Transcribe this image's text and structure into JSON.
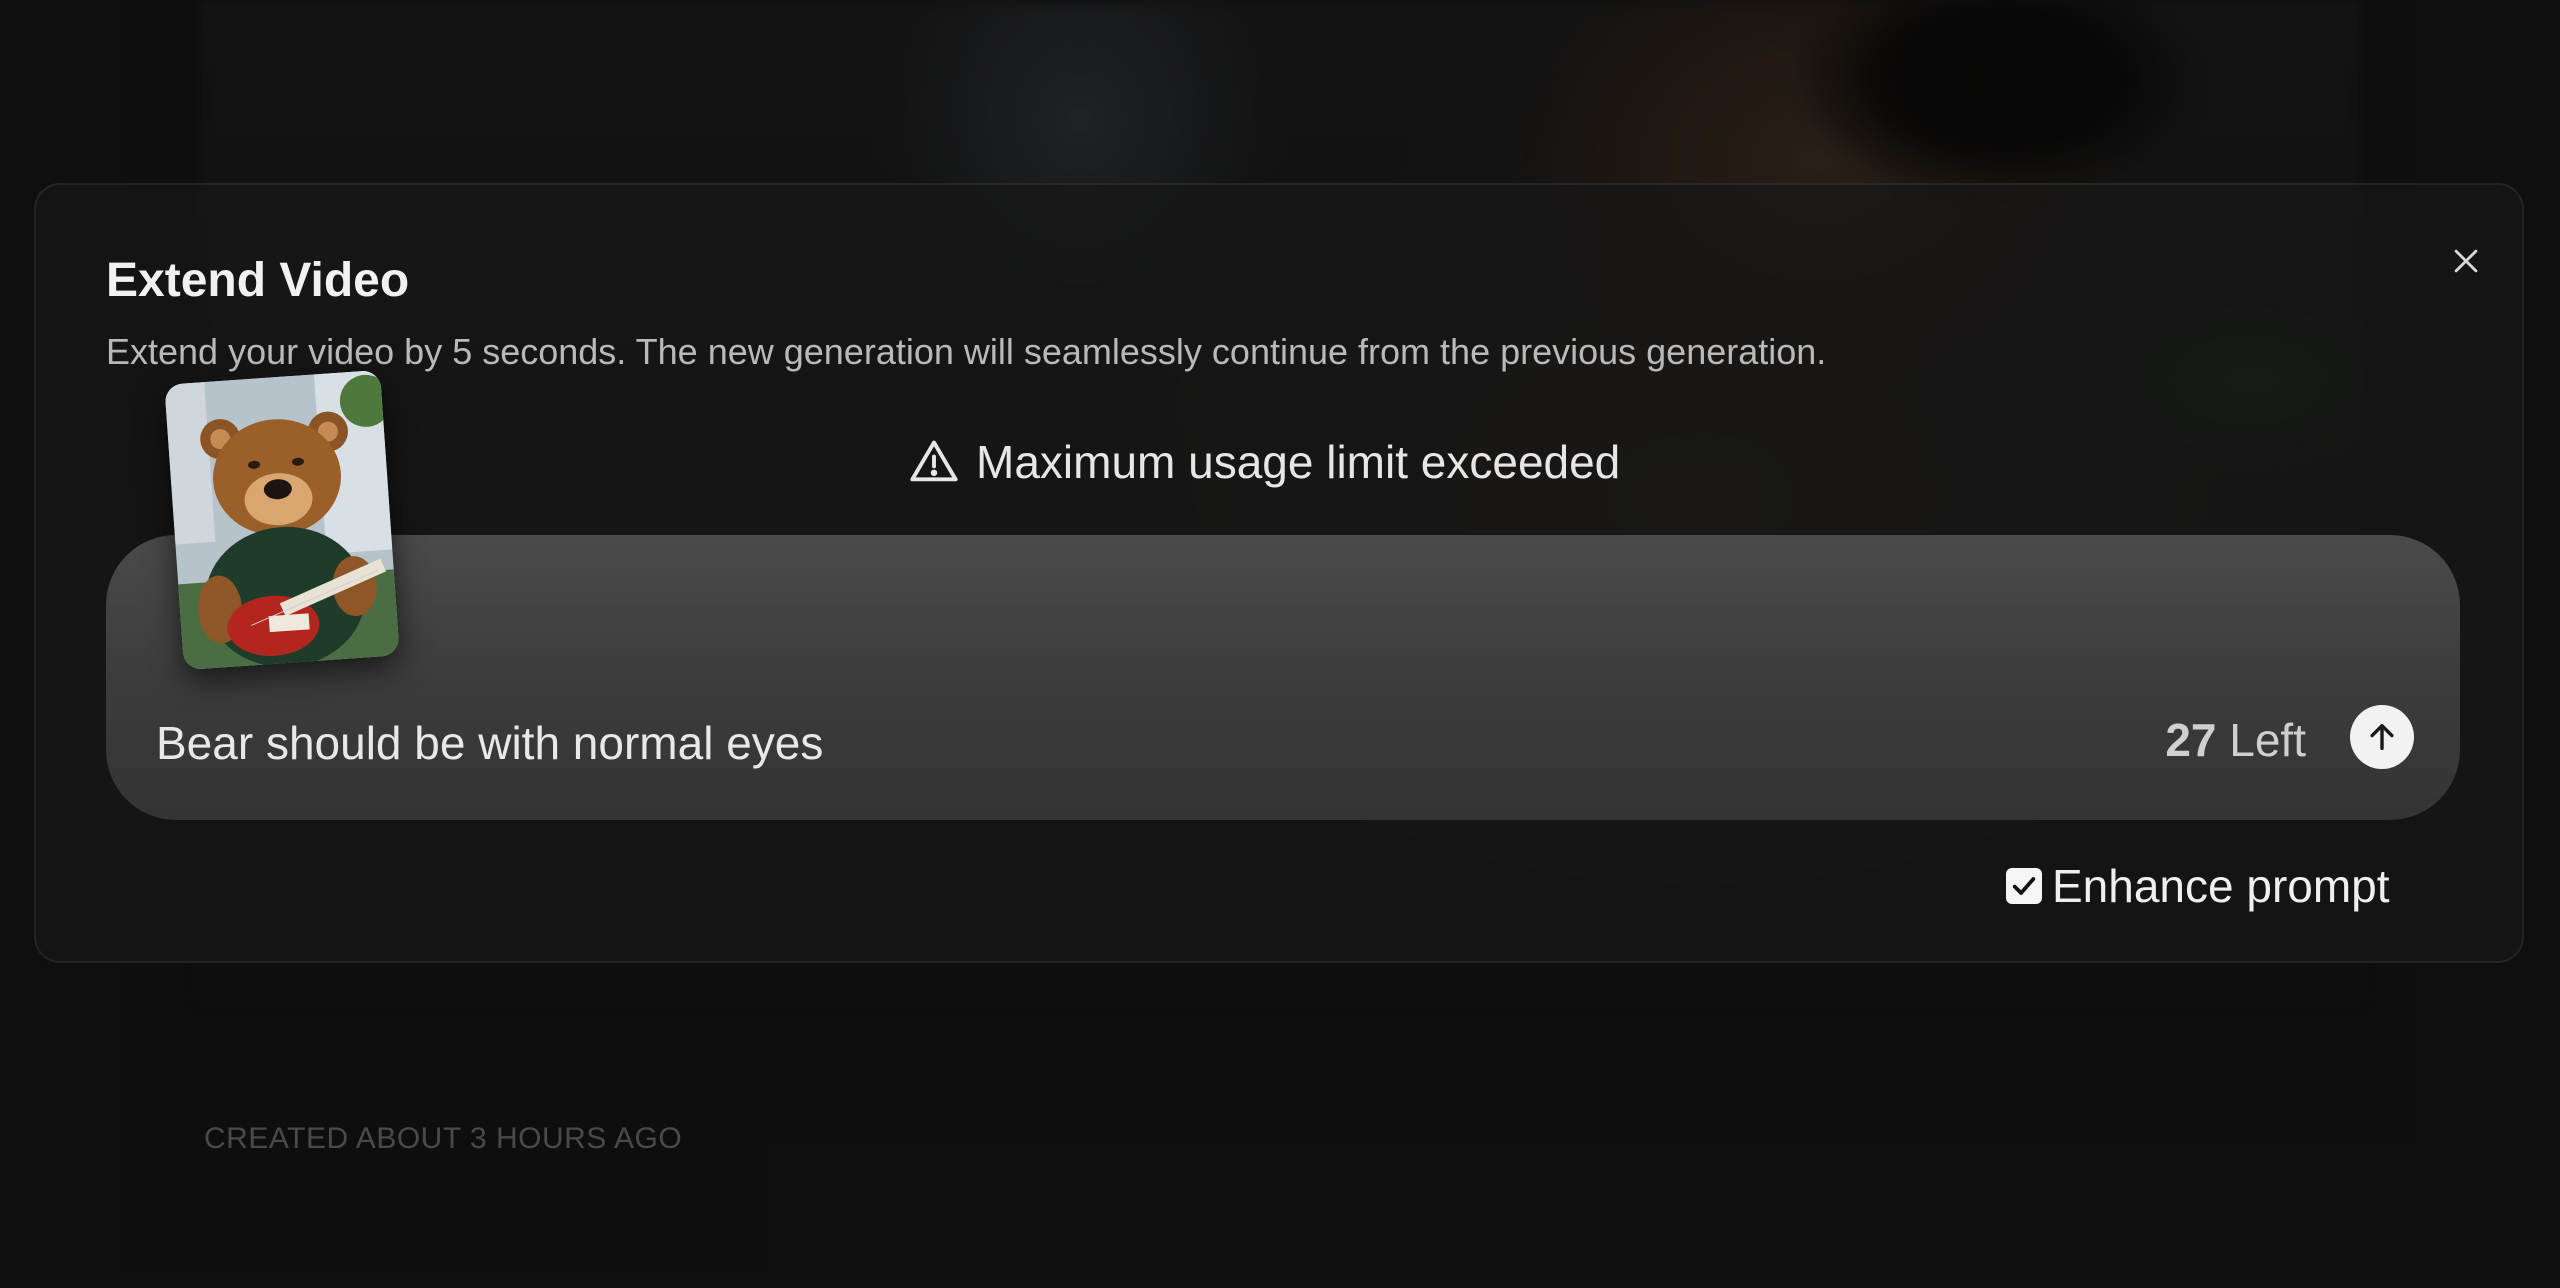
{
  "modal": {
    "title": "Extend Video",
    "description": "Extend your video by 5 seconds. The new generation will seamlessly continue from the previous generation.",
    "close_icon": "close-icon"
  },
  "warning": {
    "icon": "warning-triangle-icon",
    "text": "Maximum usage limit exceeded"
  },
  "prompt": {
    "value": "Bear should be with normal eyes",
    "remaining_count": "27",
    "remaining_suffix": " Left",
    "submit_icon": "arrow-up-icon"
  },
  "enhance": {
    "label": "Enhance prompt",
    "checked": true
  },
  "footer": {
    "created": "CREATED ABOUT 3 HOURS AGO"
  }
}
